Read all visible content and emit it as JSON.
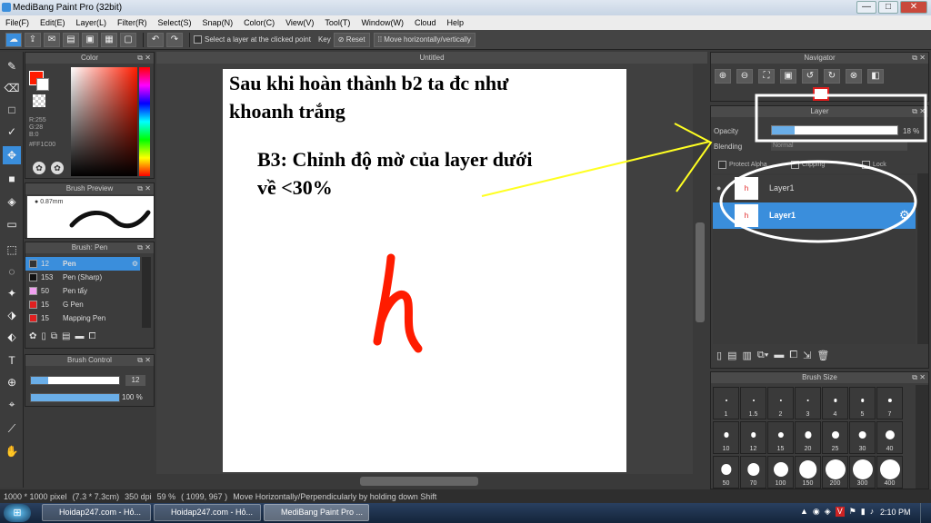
{
  "titlebar": {
    "title": "MediBang Paint Pro (32bit)",
    "min": "—",
    "max": "□",
    "close": "✕"
  },
  "menu": [
    "File(F)",
    "Edit(E)",
    "Layer(L)",
    "Filter(R)",
    "Select(S)",
    "Snap(N)",
    "Color(C)",
    "View(V)",
    "Tool(T)",
    "Window(W)",
    "Cloud",
    "Help"
  ],
  "toolbar": {
    "select_layer_label": "Select a layer at the clicked point",
    "key_label": "Key",
    "reset_label": "Reset",
    "move_label": "Move horizontally/vertically"
  },
  "color_panel": {
    "title": "Color",
    "r": "R:255",
    "g": "G:28",
    "b": "B:0",
    "hex": "#FF1C00",
    "primary": "#ff1c00"
  },
  "brush_preview": {
    "title": "Brush Preview",
    "size": "0.87mm"
  },
  "brush_panel": {
    "title": "Brush: Pen",
    "items": [
      {
        "num": "12",
        "name": "Pen",
        "color": "#333333",
        "selected": true
      },
      {
        "num": "153",
        "name": "Pen (Sharp)",
        "color": "#111111"
      },
      {
        "num": "50",
        "name": "Pen tẩy",
        "color": "#f0a0f0"
      },
      {
        "num": "15",
        "name": "G Pen",
        "color": "#e02020"
      },
      {
        "num": "15",
        "name": "Mapping Pen",
        "color": "#e02020"
      }
    ]
  },
  "brush_control": {
    "title": "Brush Control",
    "size": "12",
    "opacity": "100 %"
  },
  "canvas": {
    "tab": "Untitled"
  },
  "overlay": {
    "line1": "Sau khi hoàn thành b2 ta đc như",
    "line2": "khoanh trắng",
    "line3": "B3: Chỉnh độ mờ của layer dưới",
    "line4": "về <30%"
  },
  "navigator": {
    "title": "Navigator"
  },
  "layer_panel": {
    "title": "Layer",
    "opacity_label": "Opacity",
    "opacity_value": "18 %",
    "opacity_fraction": 0.18,
    "blending_label": "Blending",
    "blending_value": "Normal",
    "protect_alpha": "Protect Alpha",
    "clipping": "Clipping",
    "lock": "Lock",
    "layers": [
      {
        "name": "Layer1",
        "selected": false
      },
      {
        "name": "Layer1",
        "selected": true
      }
    ]
  },
  "brush_size": {
    "title": "Brush Size",
    "sizes": [
      "1",
      "1.5",
      "2",
      "3",
      "4",
      "5",
      "7",
      "10",
      "12",
      "15",
      "20",
      "25",
      "30",
      "40",
      "50",
      "70",
      "100",
      "150",
      "200",
      "300",
      "400"
    ]
  },
  "status": {
    "dims": "1000 * 1000 pixel",
    "cm": "(7.3 * 7.3cm)",
    "dpi": "350 dpi",
    "zoom": "59 %",
    "coords": "( 1099, 967 )",
    "hint": "Move Horizontally/Perpendicularly by holding down Shift"
  },
  "taskbar": {
    "tasks": [
      "Hoidap247.com - Hỏ...",
      "Hoidap247.com - Hỏ...",
      "MediBang Paint Pro ..."
    ],
    "time": "2:10 PM"
  }
}
